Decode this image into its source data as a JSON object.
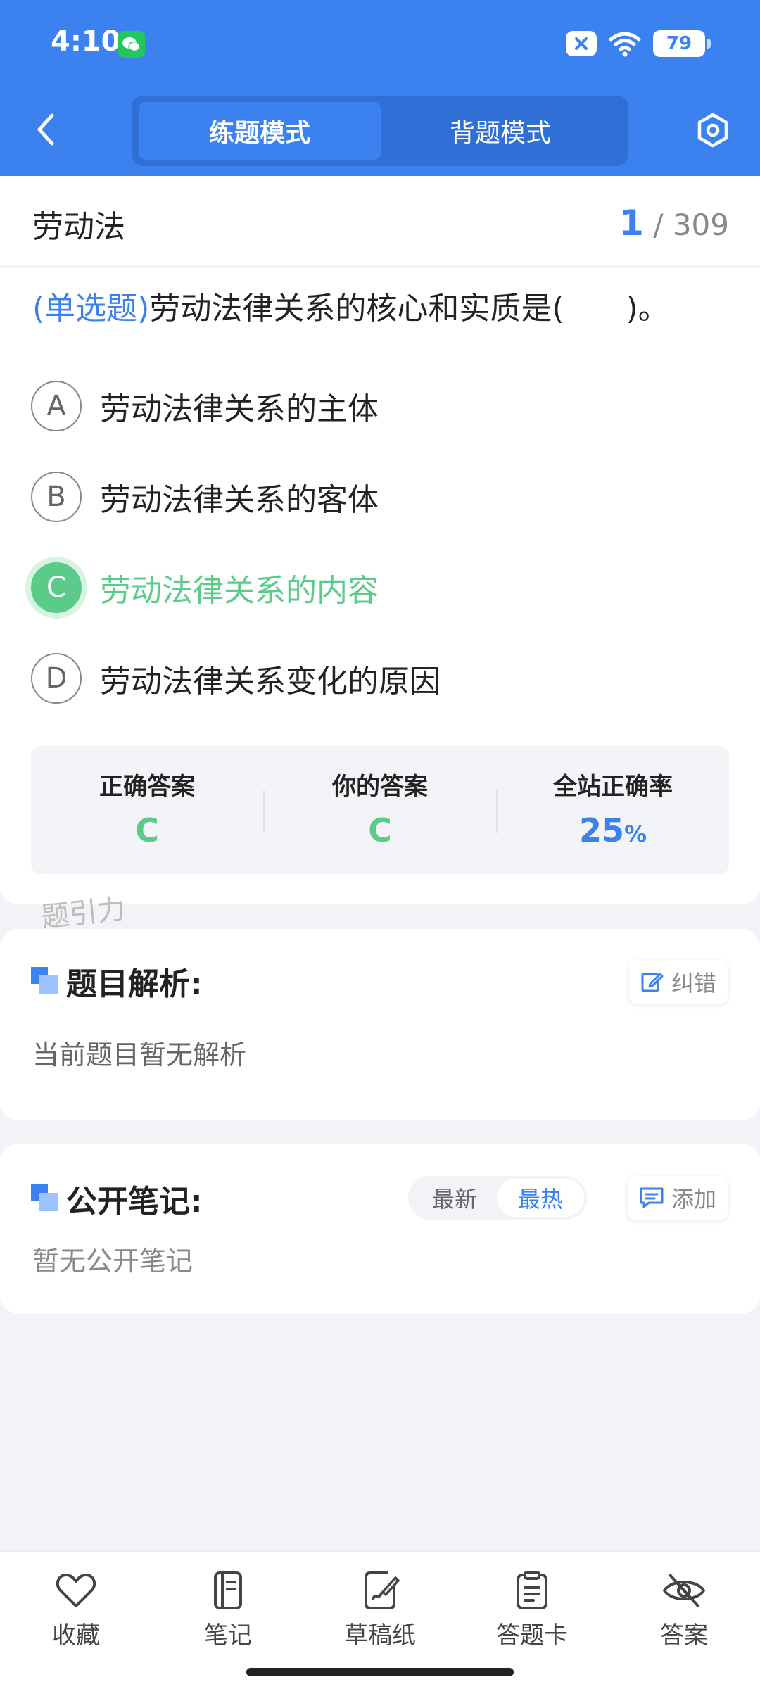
{
  "status_bar": {
    "time": "4:10",
    "battery": "79"
  },
  "header": {
    "tabs": [
      {
        "label": "练题模式",
        "active": true
      },
      {
        "label": "背题模式",
        "active": false
      }
    ]
  },
  "subject": {
    "title": "劳动法",
    "current": "1",
    "total": "/ 309"
  },
  "question": {
    "type_label": "(单选题)",
    "text": "劳动法律关系的核心和实质是(　　)。",
    "options": [
      {
        "letter": "A",
        "text": "劳动法律关系的主体"
      },
      {
        "letter": "B",
        "text": "劳动法律关系的客体"
      },
      {
        "letter": "C",
        "text": "劳动法律关系的内容",
        "correct": true
      },
      {
        "letter": "D",
        "text": "劳动法律关系变化的原因"
      }
    ]
  },
  "answer_summary": {
    "correct_label": "正确答案",
    "correct_value": "C",
    "yours_label": "你的答案",
    "yours_value": "C",
    "rate_label": "全站正确率",
    "rate_value": "25",
    "rate_unit": "%"
  },
  "watermark": "题引力",
  "analysis": {
    "title": "题目解析:",
    "correct_button": "纠错",
    "body": "当前题目暂无解析"
  },
  "notes": {
    "title": "公开笔记:",
    "sort_newest": "最新",
    "sort_hot": "最热",
    "add_button": "添加",
    "body": "暂无公开笔记"
  },
  "bottom_nav": [
    {
      "label": "收藏",
      "icon": "heart-icon"
    },
    {
      "label": "笔记",
      "icon": "notebook-icon"
    },
    {
      "label": "草稿纸",
      "icon": "draft-icon"
    },
    {
      "label": "答题卡",
      "icon": "answer-sheet-icon"
    },
    {
      "label": "答案",
      "icon": "eye-off-icon"
    }
  ],
  "colors": {
    "primary": "#3b82f0",
    "correct": "#5bcb8a",
    "background": "#f2f3f7"
  }
}
